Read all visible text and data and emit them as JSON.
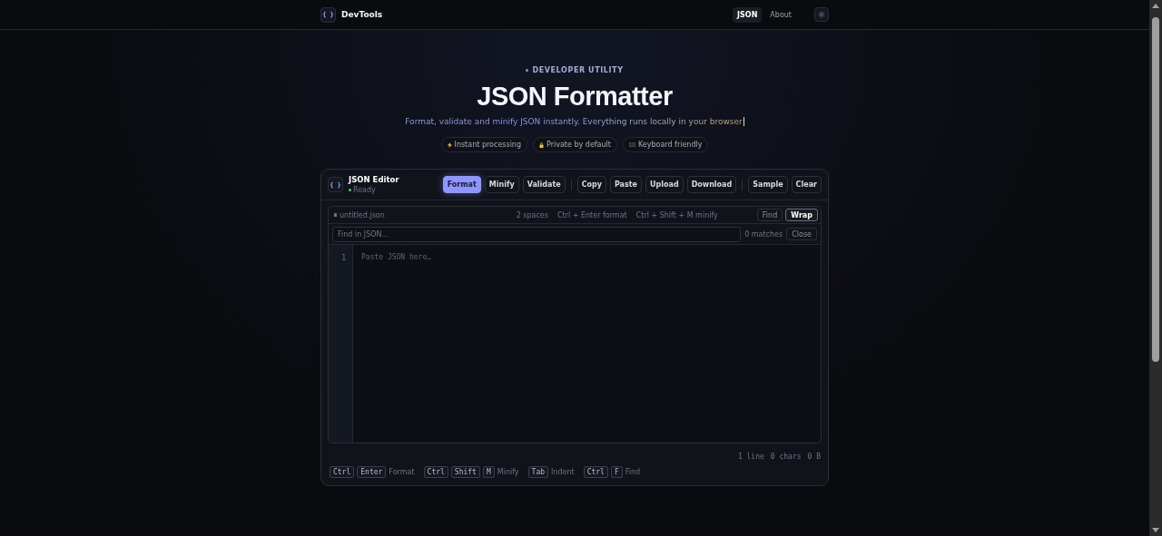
{
  "header": {
    "logo_glyph": "{ }",
    "brand": "DevTools",
    "nav": [
      {
        "label": "JSON",
        "selected": true
      },
      {
        "label": "About",
        "selected": false
      }
    ]
  },
  "hero": {
    "eyebrow": "DEVELOPER UTILITY",
    "title": "JSON Formatter",
    "subtitle": "Format, validate and minify JSON instantly. Everything runs locally in your browser",
    "pills": [
      {
        "kind": "bolt",
        "label": "Instant processing"
      },
      {
        "kind": "lock",
        "label": "Private by default"
      },
      {
        "kind": "keyboard",
        "label": "Keyboard friendly"
      }
    ]
  },
  "editor": {
    "glyph": "{ }",
    "title": "JSON Editor",
    "status": "Ready",
    "action_groups": [
      [
        {
          "label": "Format",
          "primary": true
        },
        {
          "label": "Minify",
          "primary": false
        },
        {
          "label": "Validate",
          "primary": false
        }
      ],
      [
        {
          "label": "Copy",
          "primary": false
        },
        {
          "label": "Paste",
          "primary": false
        },
        {
          "label": "Upload",
          "primary": false
        },
        {
          "label": "Download",
          "primary": false
        }
      ],
      [
        {
          "label": "Sample",
          "primary": false
        },
        {
          "label": "Clear",
          "primary": false
        }
      ]
    ],
    "filename": "untitled.json",
    "hints": [
      "2 spaces",
      "Ctrl + Enter format",
      "Ctrl + Shift + M minify"
    ],
    "toggles": [
      {
        "label": "Find",
        "selected": false
      },
      {
        "label": "Wrap",
        "selected": true
      }
    ],
    "search_placeholder": "Find in JSON...",
    "matches": "0 matches",
    "close": "Close",
    "line_numbers": [
      "1"
    ],
    "placeholder": "Paste JSON here…",
    "stats": [
      "1 line",
      "0 chars",
      "0 B"
    ],
    "shortcuts": [
      {
        "keys": [
          "Ctrl",
          "Enter"
        ],
        "label": "Format"
      },
      {
        "keys": [
          "Ctrl",
          "Shift",
          "M"
        ],
        "label": "Minify"
      },
      {
        "keys": [
          "Tab"
        ],
        "label": "Indent"
      },
      {
        "keys": [
          "Ctrl",
          "F"
        ],
        "label": "Find"
      }
    ]
  }
}
